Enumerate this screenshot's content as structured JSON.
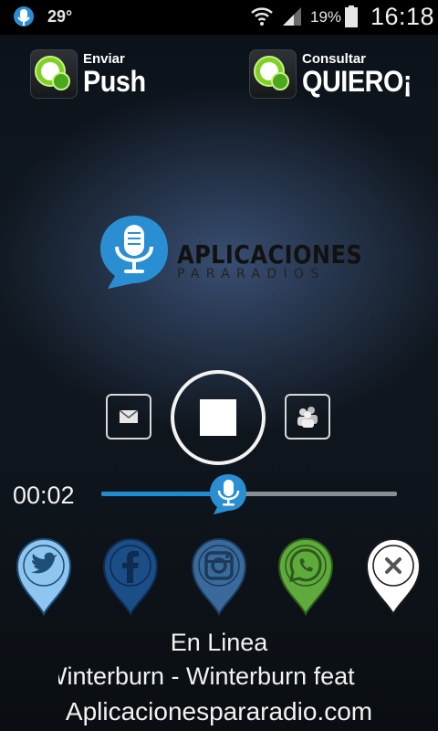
{
  "status_bar": {
    "temperature": "29°",
    "battery_percent": "19%",
    "time": "16:18",
    "icons": [
      "app-microphone-icon",
      "wifi-icon",
      "signal-icon",
      "battery-icon"
    ]
  },
  "actions": {
    "push": {
      "small": "Enviar",
      "big": "Push",
      "icon": "chat-bubble-icon"
    },
    "quiero": {
      "small": "Consultar",
      "big": "QUIERO¡",
      "icon": "chat-bubble-icon"
    }
  },
  "logo": {
    "title": "APLICACIONES",
    "subtitle": "PARARADIOS",
    "icon": "microphone-icon"
  },
  "player": {
    "elapsed": "00:02",
    "progress_fraction": 0.43,
    "controls": [
      "mail-icon",
      "stop-icon",
      "users-icon"
    ]
  },
  "social": [
    "twitter-icon",
    "facebook-icon",
    "instagram-icon",
    "whatsapp-icon",
    "close-icon"
  ],
  "colors": {
    "accent_blue": "#1e8bd0",
    "twitter": "#8ec6ef",
    "facebook": "#1b4d86",
    "instagram": "#3a6a9c",
    "whatsapp": "#5faa3c",
    "close": "#ffffff"
  },
  "footer": {
    "status": "En Linea",
    "now_playing": "Winterburn - Winterburn feat",
    "website": "Aplicacionespararadio.com"
  }
}
